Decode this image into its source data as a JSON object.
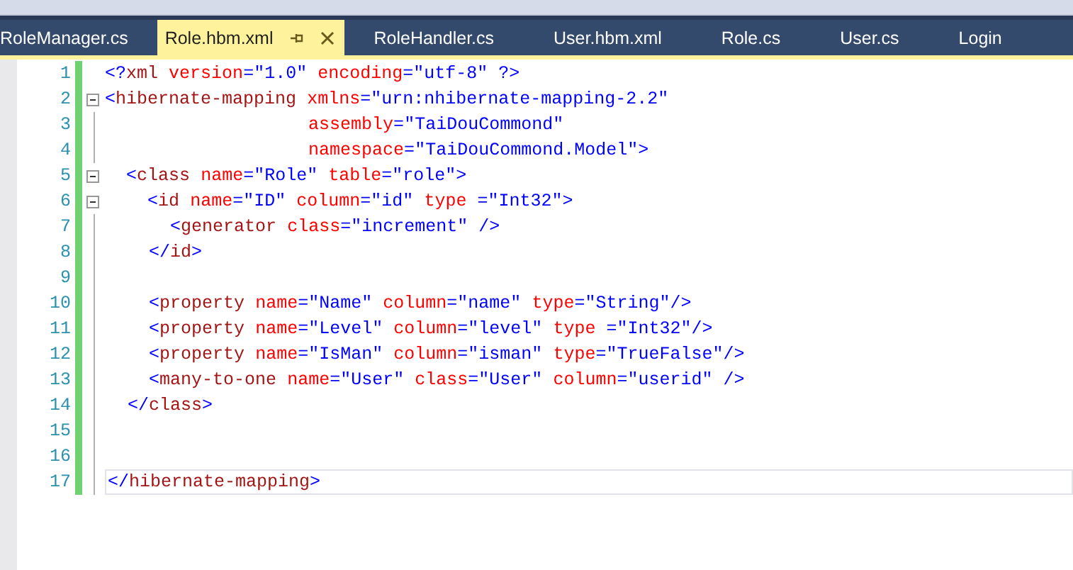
{
  "tabs": [
    {
      "label": "RoleManager.cs",
      "selected": false
    },
    {
      "label": "Role.hbm.xml",
      "selected": true
    },
    {
      "label": "RoleHandler.cs",
      "selected": false
    },
    {
      "label": "User.hbm.xml",
      "selected": false
    },
    {
      "label": "Role.cs",
      "selected": false
    },
    {
      "label": "User.cs",
      "selected": false
    },
    {
      "label": "Login",
      "selected": false
    }
  ],
  "editor": {
    "lines": [
      {
        "number": "1",
        "text": "<?xml version=\"1.0\" encoding=\"utf-8\" ?>",
        "kind": "plain",
        "modified": true,
        "current": false
      },
      {
        "number": "2",
        "text": "<hibernate-mapping xmlns=\"urn:nhibernate-mapping-2.2\"",
        "kind": "fold-start",
        "modified": true,
        "current": false
      },
      {
        "number": "3",
        "text": "                   assembly=\"TaiDouCommond\"",
        "kind": "in-fold",
        "modified": true,
        "current": false
      },
      {
        "number": "4",
        "text": "                   namespace=\"TaiDouCommond.Model\">",
        "kind": "in-fold",
        "modified": true,
        "current": false
      },
      {
        "number": "5",
        "text": "  <class name=\"Role\" table=\"role\">",
        "kind": "fold-start",
        "modified": true,
        "current": false
      },
      {
        "number": "6",
        "text": "    <id name=\"ID\" column=\"id\" type =\"Int32\">",
        "kind": "fold-start",
        "modified": true,
        "current": false
      },
      {
        "number": "7",
        "text": "      <generator class=\"increment\" />",
        "kind": "in-fold",
        "modified": true,
        "current": false
      },
      {
        "number": "8",
        "text": "    </id>",
        "kind": "in-fold",
        "modified": true,
        "current": false
      },
      {
        "number": "9",
        "kind": "in-fold",
        "modified": true,
        "current": false
      },
      {
        "number": "10",
        "text": "    <property name=\"Name\" column=\"name\" type=\"String\"/>",
        "kind": "in-fold",
        "modified": true,
        "current": false
      },
      {
        "number": "11",
        "text": "    <property name=\"Level\" column=\"level\" type =\"Int32\"/>",
        "kind": "in-fold",
        "modified": true,
        "current": false
      },
      {
        "number": "12",
        "text": "    <property name=\"IsMan\" column=\"isman\" type=\"TrueFalse\"/>",
        "kind": "in-fold",
        "modified": true,
        "current": false
      },
      {
        "number": "13",
        "text": "    <many-to-one name=\"User\" class=\"User\" column=\"userid\" />",
        "kind": "in-fold",
        "modified": true,
        "current": false
      },
      {
        "number": "14",
        "text": "  </class>",
        "kind": "in-fold",
        "modified": true,
        "current": false
      },
      {
        "number": "15",
        "kind": "in-fold",
        "modified": true,
        "current": false
      },
      {
        "number": "16",
        "kind": "in-fold",
        "modified": true,
        "current": false
      },
      {
        "number": "17",
        "text": "</hibernate-mapping>",
        "kind": "in-fold",
        "modified": true,
        "current": true
      }
    ]
  }
}
